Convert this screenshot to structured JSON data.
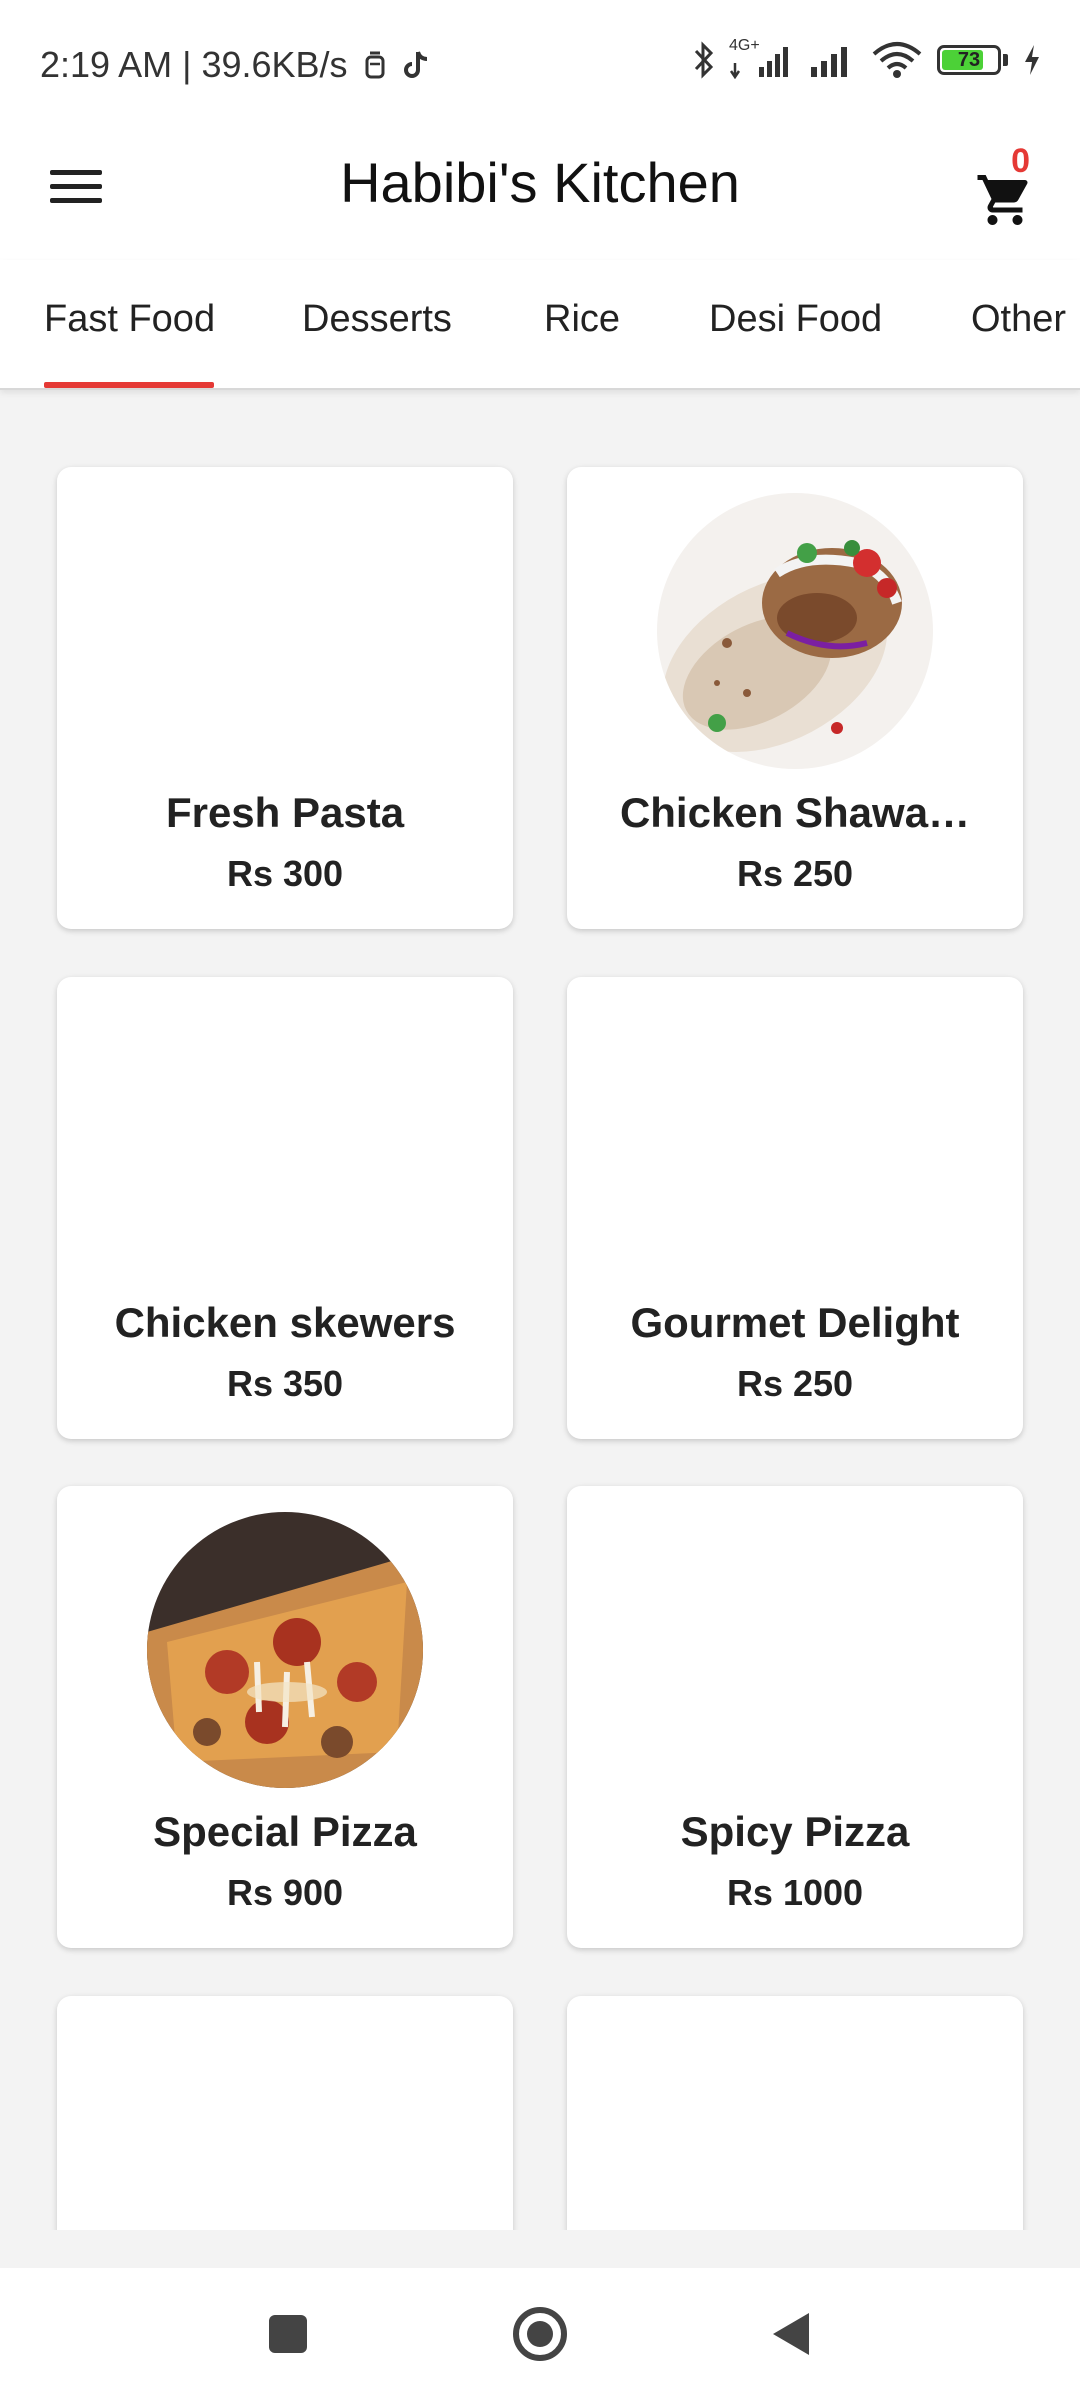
{
  "status_bar": {
    "left_text": "2:19 AM | 39.6KB/s",
    "battery": "73",
    "network_label": "4G+"
  },
  "app_bar": {
    "title": "Habibi's Kitchen",
    "cart_count": "0"
  },
  "tabs": [
    {
      "label": "Fast Food",
      "selected": true
    },
    {
      "label": "Desserts",
      "selected": false
    },
    {
      "label": "Rice",
      "selected": false
    },
    {
      "label": "Desi Food",
      "selected": false
    },
    {
      "label": "Other",
      "selected": false
    }
  ],
  "items": [
    {
      "name": "Fresh Pasta",
      "price": "Rs 300"
    },
    {
      "name": "Chicken Shawa…",
      "price": "Rs 250"
    },
    {
      "name": "Chicken skewers",
      "price": "Rs 350"
    },
    {
      "name": "Gourmet Delight",
      "price": "Rs 250"
    },
    {
      "name": "Special Pizza",
      "price": "Rs 900"
    },
    {
      "name": "Spicy Pizza",
      "price": "Rs 1000"
    }
  ],
  "colors": {
    "accent": "#e53935",
    "background": "#f3f3f3",
    "card": "#ffffff"
  }
}
